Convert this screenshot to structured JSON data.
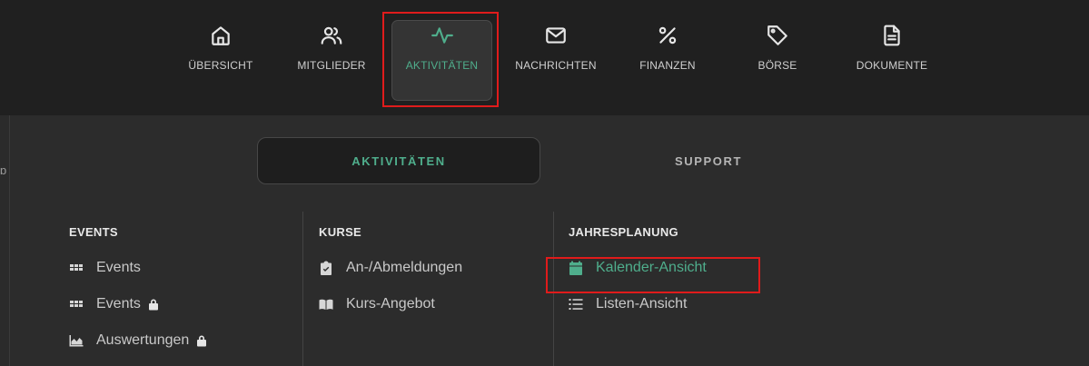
{
  "nav": {
    "items": [
      {
        "label": "ÜBERSICHT",
        "icon": "home-icon"
      },
      {
        "label": "MITGLIEDER",
        "icon": "users-icon"
      },
      {
        "label": "AKTIVITÄTEN",
        "icon": "activity-icon",
        "active": true
      },
      {
        "label": "NACHRICHTEN",
        "icon": "mail-icon"
      },
      {
        "label": "FINANZEN",
        "icon": "percent-icon"
      },
      {
        "label": "BÖRSE",
        "icon": "tag-icon"
      },
      {
        "label": "DOKUMENTE",
        "icon": "document-icon"
      }
    ]
  },
  "tabs": {
    "active": "AKTIVITÄTEN",
    "inactive": "SUPPORT"
  },
  "edge_char": "ɒ",
  "columns": {
    "events": {
      "title": "EVENTS",
      "items": [
        {
          "label": "Events",
          "icon": "grid-icon"
        },
        {
          "label": "Events",
          "icon": "grid-icon",
          "locked": true
        },
        {
          "label": "Auswertungen",
          "icon": "area-chart-icon",
          "locked": true
        }
      ]
    },
    "kurse": {
      "title": "KURSE",
      "items": [
        {
          "label": "An-/Abmeldungen",
          "icon": "clipboard-check-icon"
        },
        {
          "label": "Kurs-Angebot",
          "icon": "book-icon"
        }
      ]
    },
    "jahresplanung": {
      "title": "JAHRESPLANUNG",
      "items": [
        {
          "label": "Kalender-Ansicht",
          "icon": "calendar-icon",
          "active": true
        },
        {
          "label": "Listen-Ansicht",
          "icon": "list-icon"
        }
      ]
    }
  },
  "colors": {
    "accent": "#4fae8c",
    "highlight": "#e01b1b",
    "topbar": "#202020",
    "panel": "#2c2c2c"
  }
}
